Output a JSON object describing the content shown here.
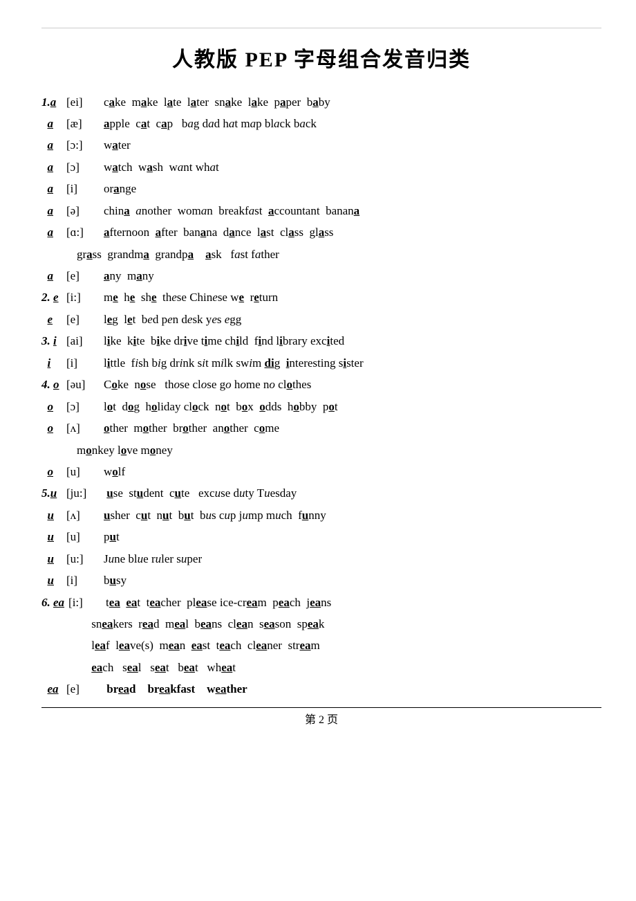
{
  "title": "人教版 PEP 字母组合发音归类",
  "footer": "第 2 页",
  "sections": []
}
